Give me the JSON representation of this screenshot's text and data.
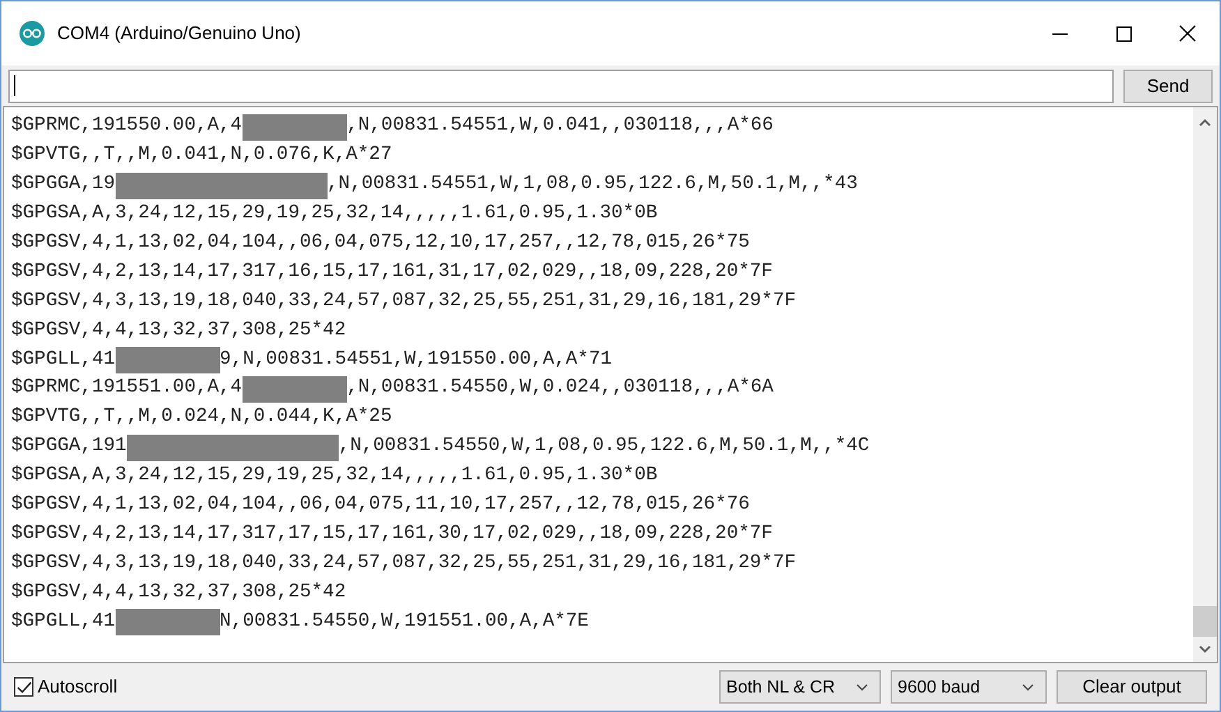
{
  "window": {
    "title": "COM4 (Arduino/Genuino Uno)"
  },
  "send_button": "Send",
  "output_lines": [
    [
      {
        "kind": "text",
        "text": "$GPRMC,191550.00,A,4"
      },
      {
        "kind": "mask"
      },
      {
        "kind": "text",
        "text": ",N,00831.54551,W,0.041,,030118,,,A*66"
      }
    ],
    [
      {
        "kind": "text",
        "text": "$GPVTG,,T,,M,0.041,N,0.076,K,A*27"
      }
    ],
    [
      {
        "kind": "text",
        "text": "$GPGGA,19"
      },
      {
        "kind": "wide-mask"
      },
      {
        "kind": "text",
        "text": ",N,00831.54551,W,1,08,0.95,122.6,M,50.1,M,,*43"
      }
    ],
    [
      {
        "kind": "text",
        "text": "$GPGSA,A,3,24,12,15,29,19,25,32,14,,,,,1.61,0.95,1.30*0B"
      }
    ],
    [
      {
        "kind": "text",
        "text": "$GPGSV,4,1,13,02,04,104,,06,04,075,12,10,17,257,,12,78,015,26*75"
      }
    ],
    [
      {
        "kind": "text",
        "text": "$GPGSV,4,2,13,14,17,317,16,15,17,161,31,17,02,029,,18,09,228,20*7F"
      }
    ],
    [
      {
        "kind": "text",
        "text": "$GPGSV,4,3,13,19,18,040,33,24,57,087,32,25,55,251,31,29,16,181,29*7F"
      }
    ],
    [
      {
        "kind": "text",
        "text": "$GPGSV,4,4,13,32,37,308,25*42"
      }
    ],
    [
      {
        "kind": "text",
        "text": "$GPGLL,41"
      },
      {
        "kind": "mask"
      },
      {
        "kind": "text",
        "text": "9,N,00831.54551,W,191550.00,A,A*71"
      }
    ],
    [
      {
        "kind": "text",
        "text": "$GPRMC,191551.00,A,4"
      },
      {
        "kind": "mask"
      },
      {
        "kind": "text",
        "text": ",N,00831.54550,W,0.024,,030118,,,A*6A"
      }
    ],
    [
      {
        "kind": "text",
        "text": "$GPVTG,,T,,M,0.024,N,0.044,K,A*25"
      }
    ],
    [
      {
        "kind": "text",
        "text": "$GPGGA,191"
      },
      {
        "kind": "wide-mask"
      },
      {
        "kind": "text",
        "text": ",N,00831.54550,W,1,08,0.95,122.6,M,50.1,M,,*4C"
      }
    ],
    [
      {
        "kind": "text",
        "text": "$GPGSA,A,3,24,12,15,29,19,25,32,14,,,,,1.61,0.95,1.30*0B"
      }
    ],
    [
      {
        "kind": "text",
        "text": "$GPGSV,4,1,13,02,04,104,,06,04,075,11,10,17,257,,12,78,015,26*76"
      }
    ],
    [
      {
        "kind": "text",
        "text": "$GPGSV,4,2,13,14,17,317,17,15,17,161,30,17,02,029,,18,09,228,20*7F"
      }
    ],
    [
      {
        "kind": "text",
        "text": "$GPGSV,4,3,13,19,18,040,33,24,57,087,32,25,55,251,31,29,16,181,29*7F"
      }
    ],
    [
      {
        "kind": "text",
        "text": "$GPGSV,4,4,13,32,37,308,25*42"
      }
    ],
    [
      {
        "kind": "text",
        "text": "$GPGLL,41"
      },
      {
        "kind": "mask"
      },
      {
        "kind": "text",
        "text": "N,00831.54550,W,191551.00,A,A*7E"
      }
    ]
  ],
  "autoscroll": {
    "label": "Autoscroll",
    "checked": true
  },
  "line_ending": "Both NL & CR",
  "baud_rate": "9600 baud",
  "clear_button": "Clear output"
}
